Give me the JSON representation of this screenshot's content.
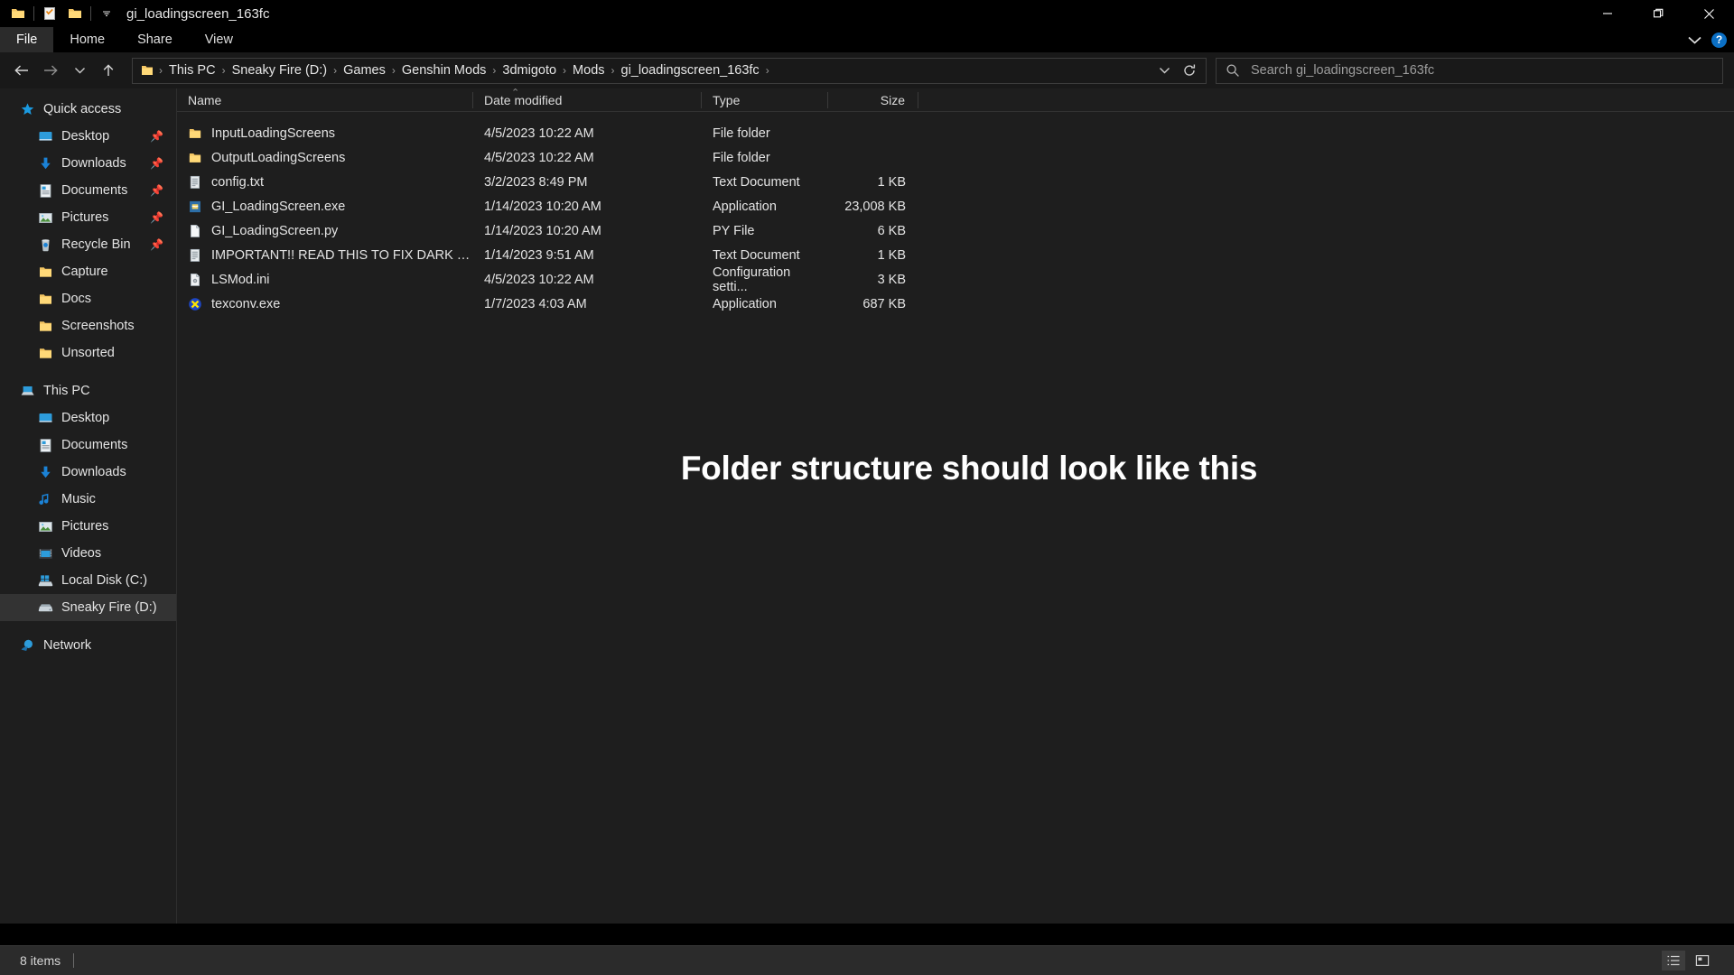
{
  "window": {
    "title": "gi_loadingscreen_163fc",
    "quick_access": [
      {
        "name": "folder-icon",
        "label": "New folder"
      },
      {
        "name": "properties-icon",
        "label": "Properties"
      },
      {
        "name": "folder-icon",
        "label": "Folder"
      },
      {
        "name": "chevron-down-icon",
        "label": "Customize Quick Access Toolbar"
      }
    ],
    "controls": {
      "minimize": "—",
      "maximize": "❐",
      "close": "✕"
    }
  },
  "ribbon": {
    "tabs": [
      {
        "label": "File",
        "active": true
      },
      {
        "label": "Home",
        "active": false
      },
      {
        "label": "Share",
        "active": false
      },
      {
        "label": "View",
        "active": false
      }
    ],
    "collapse_label": "⌄",
    "help_label": "?"
  },
  "address": {
    "back_label": "←",
    "forward_label": "→",
    "recent_label": "⌄",
    "up_label": "↑",
    "breadcrumbs": [
      "This PC",
      "Sneaky Fire (D:)",
      "Games",
      "Genshin Mods",
      "3dmigoto",
      "Mods",
      "gi_loadingscreen_163fc"
    ],
    "separator": "›",
    "dropdown_label": "⌄",
    "refresh_label": "↻"
  },
  "search": {
    "placeholder": "Search gi_loadingscreen_163fc",
    "value": ""
  },
  "sidebar": {
    "items": [
      {
        "label": "Quick access",
        "icon": "star-icon",
        "level": 0,
        "pinned": false,
        "selected": false
      },
      {
        "label": "Desktop",
        "icon": "desktop-icon",
        "level": 1,
        "pinned": true,
        "selected": false
      },
      {
        "label": "Downloads",
        "icon": "downloads-icon",
        "level": 1,
        "pinned": true,
        "selected": false
      },
      {
        "label": "Documents",
        "icon": "documents-icon",
        "level": 1,
        "pinned": true,
        "selected": false
      },
      {
        "label": "Pictures",
        "icon": "pictures-icon",
        "level": 1,
        "pinned": true,
        "selected": false
      },
      {
        "label": "Recycle Bin",
        "icon": "recycle-bin-icon",
        "level": 1,
        "pinned": true,
        "selected": false
      },
      {
        "label": "Capture",
        "icon": "folder-icon",
        "level": 1,
        "pinned": false,
        "selected": false
      },
      {
        "label": "Docs",
        "icon": "folder-icon",
        "level": 1,
        "pinned": false,
        "selected": false
      },
      {
        "label": "Screenshots",
        "icon": "folder-icon",
        "level": 1,
        "pinned": false,
        "selected": false
      },
      {
        "label": "Unsorted",
        "icon": "folder-icon",
        "level": 1,
        "pinned": false,
        "selected": false
      },
      {
        "label": "This PC",
        "icon": "this-pc-icon",
        "level": 0,
        "pinned": false,
        "selected": false,
        "gap_before": true
      },
      {
        "label": "Desktop",
        "icon": "desktop-icon",
        "level": 1,
        "pinned": false,
        "selected": false
      },
      {
        "label": "Documents",
        "icon": "documents-icon",
        "level": 1,
        "pinned": false,
        "selected": false
      },
      {
        "label": "Downloads",
        "icon": "downloads-icon",
        "level": 1,
        "pinned": false,
        "selected": false
      },
      {
        "label": "Music",
        "icon": "music-icon",
        "level": 1,
        "pinned": false,
        "selected": false
      },
      {
        "label": "Pictures",
        "icon": "pictures-icon",
        "level": 1,
        "pinned": false,
        "selected": false
      },
      {
        "label": "Videos",
        "icon": "videos-icon",
        "level": 1,
        "pinned": false,
        "selected": false
      },
      {
        "label": "Local Disk (C:)",
        "icon": "windows-drive-icon",
        "level": 1,
        "pinned": false,
        "selected": false
      },
      {
        "label": "Sneaky Fire (D:)",
        "icon": "drive-icon",
        "level": 1,
        "pinned": false,
        "selected": true
      },
      {
        "label": "Network",
        "icon": "network-icon",
        "level": 0,
        "pinned": false,
        "selected": false,
        "gap_before": true
      }
    ]
  },
  "filelist": {
    "columns": [
      {
        "label": "Name",
        "sorted": "asc"
      },
      {
        "label": "Date modified",
        "sorted": null
      },
      {
        "label": "Type",
        "sorted": null
      },
      {
        "label": "Size",
        "sorted": null
      }
    ],
    "sort_indicator": "⌃",
    "rows": [
      {
        "name": "InputLoadingScreens",
        "date": "4/5/2023 10:22 AM",
        "type": "File folder",
        "size": "",
        "icon": "folder-icon"
      },
      {
        "name": "OutputLoadingScreens",
        "date": "4/5/2023 10:22 AM",
        "type": "File folder",
        "size": "",
        "icon": "folder-icon"
      },
      {
        "name": "config.txt",
        "date": "3/2/2023 8:49 PM",
        "type": "Text Document",
        "size": "1 KB",
        "icon": "text-file-icon"
      },
      {
        "name": "GI_LoadingScreen.exe",
        "date": "1/14/2023 10:20 AM",
        "type": "Application",
        "size": "23,008 KB",
        "icon": "application-icon"
      },
      {
        "name": "GI_LoadingScreen.py",
        "date": "1/14/2023 10:20 AM",
        "type": "PY File",
        "size": "6 KB",
        "icon": "blank-file-icon"
      },
      {
        "name": "IMPORTANT!! READ THIS TO FIX DARK L...",
        "date": "1/14/2023 9:51 AM",
        "type": "Text Document",
        "size": "1 KB",
        "icon": "text-file-icon"
      },
      {
        "name": "LSMod.ini",
        "date": "4/5/2023 10:22 AM",
        "type": "Configuration setti...",
        "size": "3 KB",
        "icon": "ini-file-icon"
      },
      {
        "name": "texconv.exe",
        "date": "1/7/2023 4:03 AM",
        "type": "Application",
        "size": "687 KB",
        "icon": "texconv-icon"
      }
    ]
  },
  "annotation": {
    "text": "Folder structure should look like this"
  },
  "statusbar": {
    "item_count": "8 items",
    "details_view_label": "details-view",
    "large_icons_view_label": "large-icons-view"
  },
  "colors": {
    "window_bg": "#1e1e1e",
    "titlebar_bg": "#000000",
    "selection": "#333333",
    "accent": "#0b6fc4",
    "folder_yellow": "#f5c869",
    "text": "#e4e4e4"
  }
}
